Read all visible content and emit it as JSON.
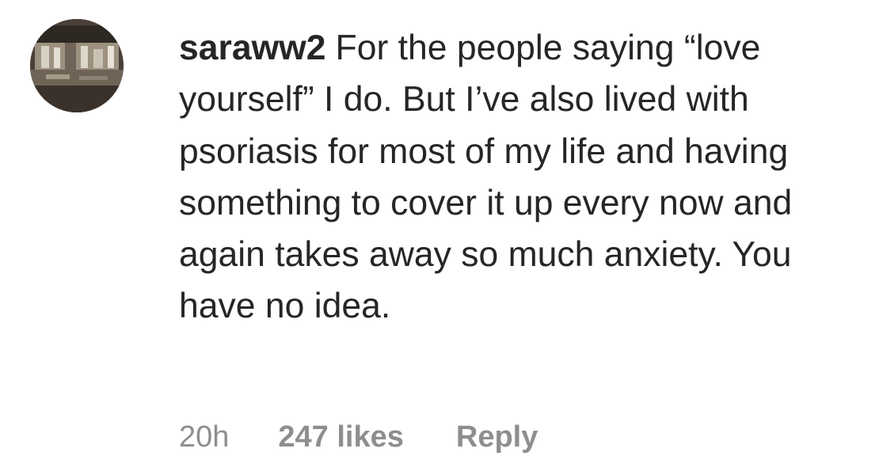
{
  "comment": {
    "username": "saraww2",
    "text": "For the people saying “love yourself” I do. But I’ve also lived with psoriasis for most of my life and having something to cover it up every now and again takes away so much anxiety. You have no idea.",
    "time": "20h",
    "likes": "247 likes",
    "reply_label": "Reply",
    "avatar_icon": "profile-photo"
  },
  "colors": {
    "text": "#262626",
    "meta": "#8e8e8e"
  }
}
